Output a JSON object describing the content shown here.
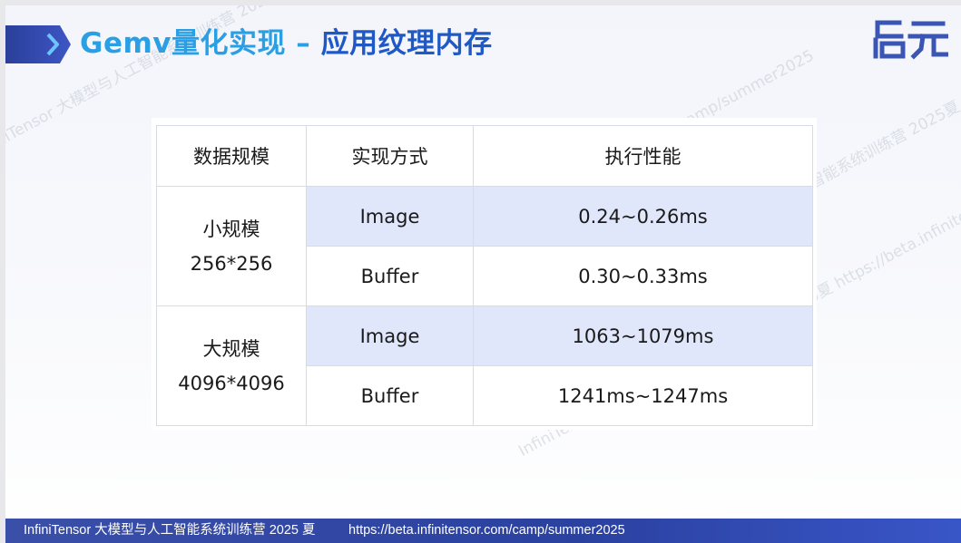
{
  "slide": {
    "title_part1": "Gemv量化实现 – ",
    "title_part2": "应用纹理内存",
    "logo_text": "启元",
    "logo_color": "#3a55b4",
    "accent_color": "#2a9fe4",
    "title_color": "#1f59c6"
  },
  "table": {
    "headers": [
      "数据规模",
      "实现方式",
      "执行性能"
    ],
    "groups": [
      {
        "scale_name": "小规模",
        "scale_size": "256*256",
        "rows": [
          {
            "method": "Image",
            "perf": "0.24~0.26ms"
          },
          {
            "method": "Buffer",
            "perf": "0.30~0.33ms"
          }
        ]
      },
      {
        "scale_name": "大规模",
        "scale_size": "4096*4096",
        "rows": [
          {
            "method": "Image",
            "perf": "1063~1079ms"
          },
          {
            "method": "Buffer",
            "perf": "1241ms~1247ms"
          }
        ]
      }
    ]
  },
  "watermarks": [
    "InfiniTensor 大模型与人工智能系统训练营 2025夏 https://beta.infinitensor.com/camp/summer2025"
  ],
  "footer": {
    "camp_name": "InfiniTensor 大模型与人工智能系统训练营 2025 夏",
    "url": "https://beta.infinitensor.com/camp/summer2025"
  }
}
